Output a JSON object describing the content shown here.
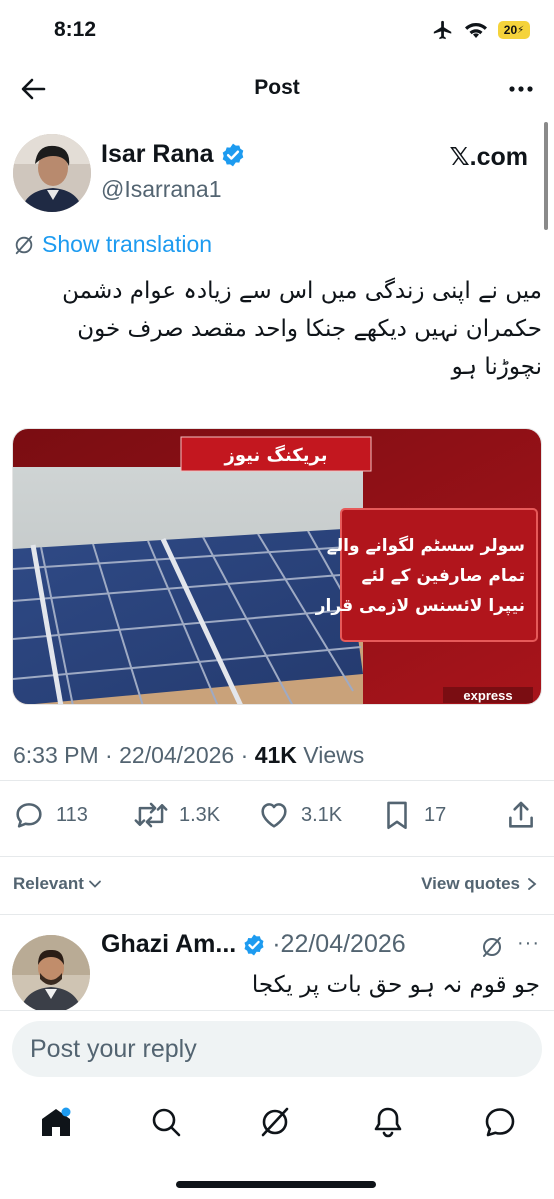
{
  "status_bar": {
    "time": "8:12",
    "battery": "20"
  },
  "header": {
    "title": "Post"
  },
  "author": {
    "name": "Isar Rana",
    "handle": "@Isarrana1",
    "source": "𝕏.com"
  },
  "translation": {
    "label": "Show translation"
  },
  "tweet": {
    "text": "میں نے اپنی زندگی میں اس سے زیادہ عوام دشمن حکمران نہیں دیکھے جنکا واحد مقصد صرف خون نچوڑنا ہو"
  },
  "media": {
    "breaking_label": "بریکنگ نیوز",
    "headline_lines": [
      "سولر سسٹم لگوانے والے",
      "تمام صارفین کے لئے",
      "نیپرا لائسنس لازمی قرار"
    ],
    "channel": "express"
  },
  "meta": {
    "time": "6:33 PM",
    "date": "22/04/2026",
    "views_count": "41K",
    "views_label": "Views"
  },
  "actions": {
    "replies": "113",
    "reposts": "1.3K",
    "likes": "3.1K",
    "bookmarks": "17"
  },
  "filter": {
    "relevant": "Relevant",
    "view_quotes": "View quotes"
  },
  "reply": {
    "name": "Ghazi Am...",
    "date": "·22/04/2026",
    "more": "···",
    "text": "جو قوم نہ ہو حق بات پر یکجا"
  },
  "composer": {
    "placeholder": "Post your reply"
  },
  "colors": {
    "accent": "#1d9bf0",
    "verified": "#1d9bf0",
    "secondary_text": "#536471"
  }
}
